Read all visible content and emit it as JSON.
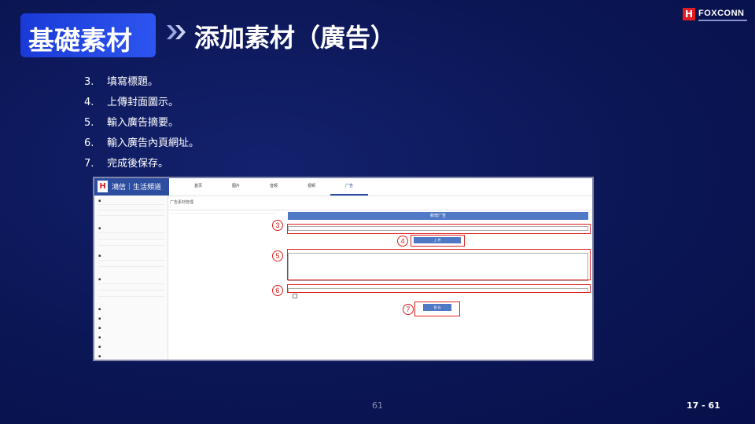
{
  "header": {
    "section_tag": "基礎素材",
    "title": "添加素材（廣告）"
  },
  "logo": {
    "mark": "H",
    "text": "FOXCONN"
  },
  "steps": [
    {
      "num": "3.",
      "text": "填寫標題。"
    },
    {
      "num": "4.",
      "text": "上傳封面圖示。"
    },
    {
      "num": "5.",
      "text": "輸入廣告摘要。"
    },
    {
      "num": "6.",
      "text": "輸入廣告內頁網址。"
    },
    {
      "num": "7.",
      "text": "完成後保存。"
    }
  ],
  "screenshot": {
    "brand_icon": "H",
    "brand_name": "鴻信｜生活頻道",
    "tabs": [
      "首页",
      "图片",
      "音频",
      "视频",
      "广告"
    ],
    "active_tab": 4,
    "breadcrumb": "广告素材管理",
    "form_header": "新增广告",
    "upload_label": "上 传",
    "save_label": "保 存",
    "callouts": [
      "3",
      "4",
      "5",
      "6",
      "7"
    ]
  },
  "footer": {
    "page_number": "61",
    "page_ref": "17 - 61"
  },
  "colors": {
    "accent": "#2d55f0",
    "highlight": "#e02020",
    "form_blue": "#4f79c5"
  }
}
